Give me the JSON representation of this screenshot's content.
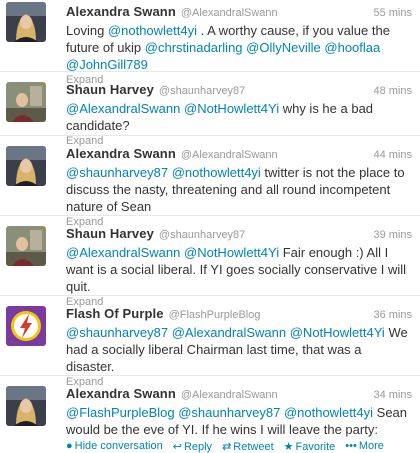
{
  "tweets": [
    {
      "name": "Alexandra Swann",
      "handle": "@AlexandralSwann",
      "time": "55 mins",
      "text_plain_1": "Loving ",
      "mention_1": "@nothowlett4yi",
      "text_plain_2": " . A worthy cause, if you value the future of ukip ",
      "mention_2": "@chrstinadarling",
      "mention_3": "@OllyNeville",
      "mention_4": "@hooflaa",
      "mention_5": "@JohnGill789",
      "expand": "Expand"
    },
    {
      "name": "Shaun Harvey",
      "handle": "@shaunharvey87",
      "time": "48 mins",
      "mention_1": "@AlexandralSwann",
      "mention_2": "@NotHowlett4Yi",
      "text_plain_1": " why is he a bad candidate?",
      "expand": "Expand"
    },
    {
      "name": "Alexandra Swann",
      "handle": "@AlexandralSwann",
      "time": "44 mins",
      "mention_1": "@shaunharvey87",
      "mention_2": "@nothowlett4yi",
      "text_plain_1": " twitter is not the place to discuss the nasty, threatening and all round incompetent nature of Sean",
      "expand": "Expand"
    },
    {
      "name": "Shaun Harvey",
      "handle": "@shaunharvey87",
      "time": "39 mins",
      "mention_1": "@AlexandralSwann",
      "mention_2": "@NotHowlett4Yi",
      "text_plain_1": " Fair enough :) All I want is a social liberal. If YI goes socially conservative I will quit.",
      "expand": "Expand"
    },
    {
      "name": "Flash Of Purple",
      "handle": "@FlashPurpleBlog",
      "time": "36 mins",
      "mention_1": "@shaunharvey87",
      "mention_2": "@AlexandralSwann",
      "mention_3": "@NotHowlett4Yi",
      "text_plain_1": " We had a socially liberal Chairman last time, that was a disaster.",
      "expand": "Expand"
    },
    {
      "name": "Alexandra Swann",
      "handle": "@AlexandralSwann",
      "time": "34 mins",
      "mention_1": "@FlashPurpleBlog",
      "mention_2": "@shaunharvey87",
      "mention_3": "@nothowlett4yi",
      "text_plain_1": " Sean would be the eve of YI. If he wins I will leave the party:"
    }
  ],
  "actions": {
    "hide_conversation": "Hide conversation",
    "reply": "Reply",
    "retweet": "Retweet",
    "favorite": "Favorite",
    "more": "More"
  },
  "colors": {
    "link": "#0084b4",
    "muted": "#999999",
    "text": "#333333",
    "flash_bg": "#7a3aa0",
    "flash_bolt": "#f2c60a"
  }
}
